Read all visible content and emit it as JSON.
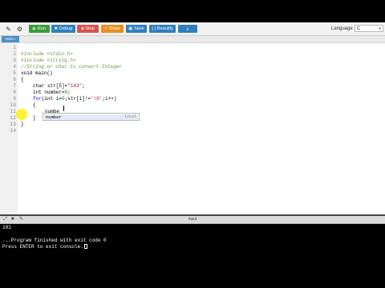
{
  "toolbar": {
    "run_label": "Run",
    "debug_label": "Debug",
    "stop_label": "Stop",
    "share_label": "Share",
    "save_label": "Save",
    "beautify_label": "{ } Beautify",
    "colors": {
      "run": "#3a9d3a",
      "debug": "#2f7fbf",
      "stop": "#d9534f",
      "share": "#e88f1f",
      "save": "#2f7fbf",
      "beautify": "#2f7fbf",
      "download": "#2f7fbf"
    }
  },
  "language": {
    "label": "Language",
    "selected": "C"
  },
  "file_tab": {
    "name": "main.c"
  },
  "editor": {
    "line_numbers": [
      "1",
      "2",
      "3",
      "4",
      "5",
      "6",
      "7",
      "8",
      "9",
      "10",
      "11",
      "12",
      "13",
      "14"
    ],
    "lines": {
      "l2": "#include <stdio.h>",
      "l3": "#include <string.h>",
      "l4": "//String or char to convert Integer",
      "l5": "void main()",
      "l6": "{",
      "l7_a": "char str[5]=",
      "l7_b": "\"143\"",
      "l7_c": ";",
      "l8_a": "int number=",
      "l8_b": "0",
      "l8_c": ";",
      "l9_a": "for",
      "l9_b": "(int i=",
      "l9_c": "0",
      "l9_d": ";str[i]!=",
      "l9_e": "'\\0'",
      "l9_f": ";i++)",
      "l10": "{",
      "l11": "numbe",
      "l12": "}",
      "l13": "}"
    },
    "autocomplete": {
      "suggestion": "number",
      "scope": "local"
    }
  },
  "console": {
    "title": "input",
    "lines": [
      "101",
      "",
      "...Program finished with exit code 0",
      "Press ENTER to exit console."
    ]
  }
}
